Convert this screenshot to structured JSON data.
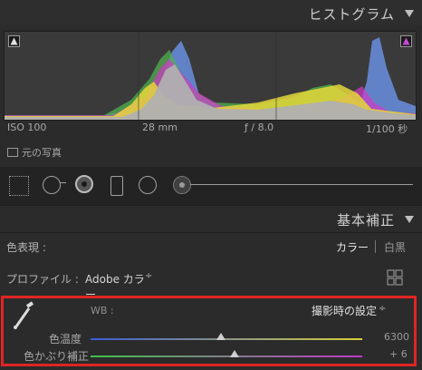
{
  "histogram_panel": {
    "title": "ヒストグラム",
    "exif": {
      "iso": "ISO 100",
      "focal": "28 mm",
      "aperture": "ƒ / 8.0",
      "shutter": "1/100 秒"
    },
    "original_photo_label": "元の写真"
  },
  "basic_panel": {
    "title": "基本補正",
    "treatment_label": "色表現 :",
    "treatment_color": "カラー",
    "treatment_bw": "白黒",
    "profile_label": "プロファイル :",
    "profile_value": "Adobe カラー",
    "profile_arrows": "÷"
  },
  "white_balance": {
    "wb_label": "WB :",
    "wb_value": "撮影時の設定",
    "temp_label": "色温度",
    "temp_value": "6300",
    "temp_level": 0.48,
    "tint_label": "色かぶり補正",
    "tint_value": "+ 6",
    "tint_level": 0.53
  },
  "colors": {
    "highlight_border": "#e02424",
    "panel_bg": "#2b2b2b"
  }
}
